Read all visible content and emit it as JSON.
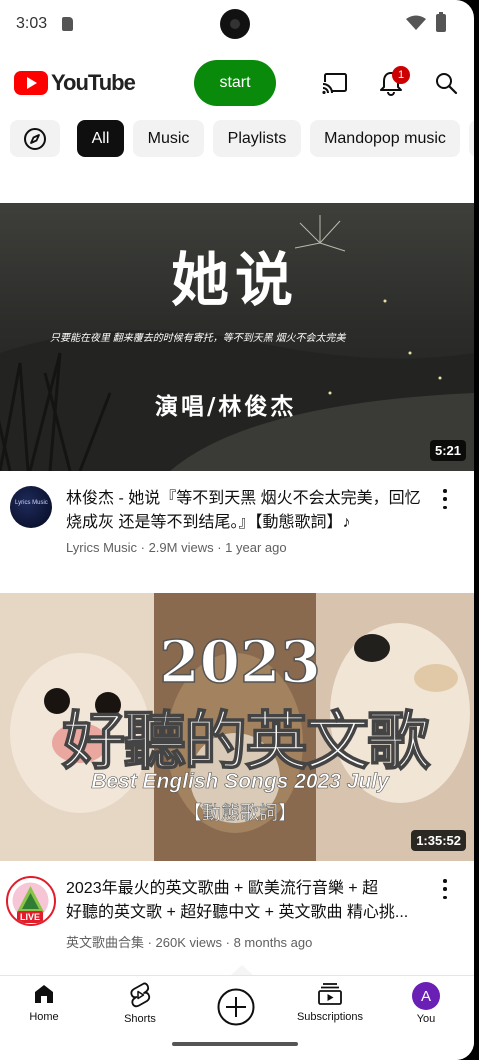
{
  "status": {
    "time": "3:03"
  },
  "header": {
    "logo_text": "YouTube",
    "start_label": "start",
    "notifications_count": "1"
  },
  "chips": [
    "All",
    "Music",
    "Playlists",
    "Mandopop music"
  ],
  "videos": [
    {
      "thumb_title": "她说",
      "thumb_subtitle": "只要能在夜里 翻来覆去的时候有寄托，等不到天黑 烟火不会太完美",
      "thumb_singer": "演唱/林俊杰",
      "duration": "5:21",
      "title": "林俊杰 - 她说『等不到天黑 烟火不会太完美，回忆烧成灰 还是等不到结尾。』【動態歌詞】♪",
      "channel_line": "Lyrics Music · 2.9M views · 1 year ago",
      "avatar_text": "Lyrics Music"
    },
    {
      "thumb_year": "2023",
      "thumb_big": "好聽的英文歌",
      "thumb_english": "Best English Songs 2023 July",
      "thumb_tag": "【動態歌詞】",
      "duration": "1:35:52",
      "title_line1": "2023年最火的英文歌曲 + 歐美流行音樂 + 超",
      "title_line2": "好聽的英文歌 + 超好聽中文 + 英文歌曲 精心挑...",
      "channel_line": "英文歌曲合集 · 260K views · 8 months ago",
      "live_label": "LIVE"
    }
  ],
  "nav": {
    "home": "Home",
    "shorts": "Shorts",
    "subscriptions": "Subscriptions",
    "you": "You",
    "you_initial": "A"
  },
  "colors": {
    "accent_red": "#ff0000",
    "start_green": "#0a8a0a",
    "you_purple": "#6a1fb5"
  }
}
